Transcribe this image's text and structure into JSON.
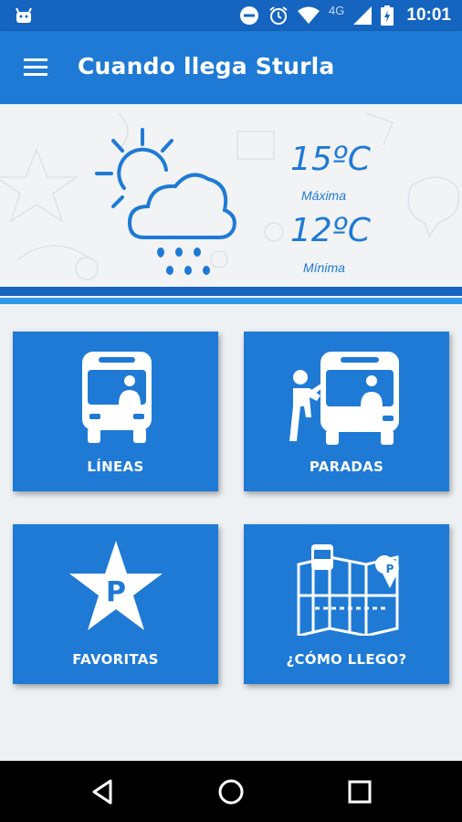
{
  "status_bar": {
    "time": "10:01",
    "network": "4G",
    "icons": [
      "android-icon",
      "do-not-disturb-icon",
      "alarm-icon",
      "wifi-icon",
      "signal-icon",
      "battery-charging-icon"
    ]
  },
  "app_bar": {
    "title": "Cuando llega Sturla",
    "menu_icon": "hamburger-menu-icon"
  },
  "weather": {
    "icon": "partly-cloudy-rain-icon",
    "max_temp": "15ºC",
    "max_label": "Máxima",
    "min_temp": "12ºC",
    "min_label": "Mínima"
  },
  "tiles": [
    {
      "label": "LÍNEAS",
      "icon": "bus-front-icon"
    },
    {
      "label": "PARADAS",
      "icon": "bus-stop-boarding-icon"
    },
    {
      "label": "FAVORITAS",
      "icon": "star-parking-icon"
    },
    {
      "label": "¿CÓMO LLEGO?",
      "icon": "route-map-icon"
    }
  ],
  "colors": {
    "status_bar": "#1565c0",
    "app_bar": "#1e7ad5",
    "tile": "#1e7ad5",
    "accent_light": "#2f9be8",
    "background": "#eef1f3"
  },
  "nav_bar": {
    "buttons": [
      "back-icon",
      "home-icon",
      "recents-icon"
    ]
  }
}
